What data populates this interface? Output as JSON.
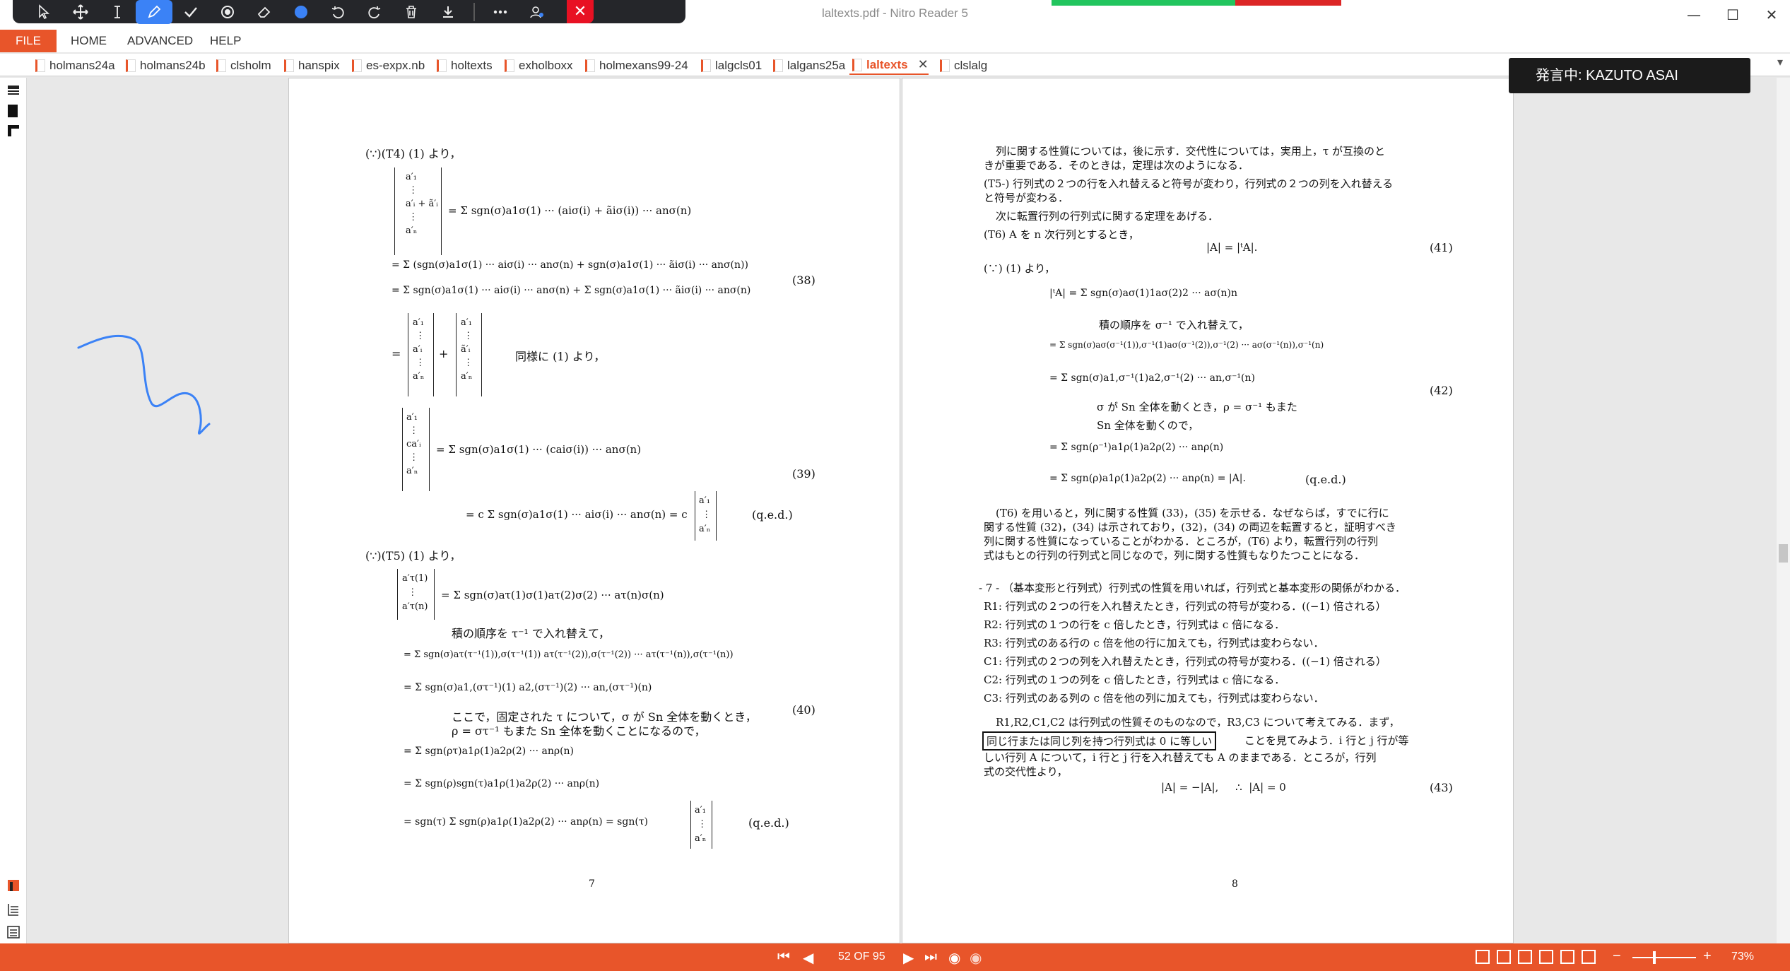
{
  "window": {
    "title": "laltexts.pdf - Nitro Reader 5",
    "minimize": "—",
    "maximize": "☐",
    "close": "✕"
  },
  "ink_toolbar": {
    "tools": [
      "select-arrow-icon",
      "move-icon",
      "text-cursor-icon",
      "pen-icon",
      "check-icon",
      "stamp-icon",
      "eraser-icon",
      "color-dot-icon",
      "undo-icon",
      "redo-icon",
      "trash-icon",
      "download-icon",
      "more-icon",
      "settings-icon"
    ],
    "active": "pen-icon",
    "accent": "#3b82f6",
    "close_color": "#e81123"
  },
  "menu": {
    "file": "FILE",
    "items": [
      "HOME",
      "ADVANCED",
      "HELP"
    ],
    "accent": "#e8552a"
  },
  "tabs": [
    {
      "label": "holmans24a"
    },
    {
      "label": "holmans24b"
    },
    {
      "label": "clsholm"
    },
    {
      "label": "hanspix"
    },
    {
      "label": "es-expx.nb"
    },
    {
      "label": "holtexts"
    },
    {
      "label": "exholboxx"
    },
    {
      "label": "holmexans99-24"
    },
    {
      "label": "lalgcls01"
    },
    {
      "label": "lalgans25a"
    },
    {
      "label": "laltexts",
      "active": true
    },
    {
      "label": "clslalg"
    }
  ],
  "tab_close": "✕",
  "speaker": {
    "text": "発言中: KAZUTO ASAI"
  },
  "page_left": {
    "lines": [
      "(∵)(T4) (1) より，",
      "= Σ sgn(σ)a1σ(1) ··· (aiσ(i) + ãiσ(i)) ··· anσ(n)",
      "= Σ (sgn(σ)a1σ(1) ··· aiσ(i) ··· anσ(n) + sgn(σ)a1σ(1) ··· ãiσ(i) ··· anσ(n))",
      "= Σ sgn(σ)a1σ(1) ··· aiσ(i) ··· anσ(n) + Σ sgn(σ)a1σ(1) ··· ãiσ(i) ··· anσ(n)",
      "同様に (1) より，",
      "= Σ sgn(σ)a1σ(1) ··· (caiσ(i)) ··· anσ(n)",
      "= c Σ sgn(σ)a1σ(1) ··· aiσ(i) ··· anσ(n) = c",
      "(q.e.d.)",
      "(∵)(T5) (1) より，",
      "= Σ sgn(σ)aτ(1)σ(1)aτ(2)σ(2) ··· aτ(n)σ(n)",
      "積の順序を τ⁻¹ で入れ替えて，",
      "= Σ sgn(σ)aτ(τ⁻¹(1)),σ(τ⁻¹(1)) aτ(τ⁻¹(2)),σ(τ⁻¹(2)) ··· aτ(τ⁻¹(n)),σ(τ⁻¹(n))",
      "= Σ sgn(σ)a1,(στ⁻¹)(1) a2,(στ⁻¹)(2) ··· an,(στ⁻¹)(n)",
      "ここで，固定された τ について，σ が Sn 全体を動くとき，",
      "ρ = στ⁻¹ もまた Sn 全体を動くことになるので，",
      "= Σ sgn(ρτ)a1ρ(1)a2ρ(2) ··· anρ(n)",
      "= Σ sgn(ρ)sgn(τ)a1ρ(1)a2ρ(2) ··· anρ(n)",
      "= sgn(τ) Σ sgn(ρ)a1ρ(1)a2ρ(2) ··· anρ(n) = sgn(τ)",
      "(q.e.d.)"
    ],
    "eq_numbers": [
      "(38)",
      "(39)",
      "(40)"
    ],
    "page_number": "7"
  },
  "page_right": {
    "lines": [
      "列に関する性質については，後に示す．交代性については，実用上，τ が互換のと",
      "きが重要である．そのときは，定理は次のようになる．",
      "(T5-) 行列式の２つの行を入れ替えると符号が変わり，行列式の２つの列を入れ替える",
      "と符号が変わる．",
      "次に転置行列の行列式に関する定理をあげる．",
      "(T6) A を n 次行列とするとき，",
      "|A| = |ᵗA|.",
      "(∵) (1) より，",
      "|ᵗA| = Σ sgn(σ)aσ(1)1aσ(2)2 ··· aσ(n)n",
      "積の順序を σ⁻¹ で入れ替えて，",
      "= Σ sgn(σ)aσ(σ⁻¹(1)),σ⁻¹(1)aσ(σ⁻¹(2)),σ⁻¹(2) ··· aσ(σ⁻¹(n)),σ⁻¹(n)",
      "= Σ sgn(σ)a1,σ⁻¹(1)a2,σ⁻¹(2) ··· an,σ⁻¹(n)",
      "σ が Sn 全体を動くとき，ρ = σ⁻¹ もまた",
      "Sn 全体を動くので，",
      "= Σ sgn(ρ⁻¹)a1ρ(1)a2ρ(2) ··· anρ(n)",
      "= Σ sgn(ρ)a1ρ(1)a2ρ(2) ··· anρ(n) = |A|.",
      "(q.e.d.)",
      "(T6) を用いると，列に関する性質 (33)，(35) を示せる．なぜならば，すでに行に",
      "関する性質 (32)，(34) は示されており，(32)，(34) の両辺を転置すると，証明すべき",
      "列に関する性質になっていることがわかる．ところが，(T6) より，転置行列の行列",
      "式はもとの行列の行列式と同じなので，列に関する性質もなりたつことになる．",
      "- 7 - （基本変形と行列式）行列式の性質を用いれば，行列式と基本変形の関係がわかる．",
      "R1: 行列式の２つの行を入れ替えたとき，行列式の符号が変わる．((−1) 倍される）",
      "R2: 行列式の１つの行を c 倍したとき，行列式は c 倍になる．",
      "R3: 行列式のある行の c 倍を他の行に加えても，行列式は変わらない．",
      "C1: 行列式の２つの列を入れ替えたとき，行列式の符号が変わる．((−1) 倍される）",
      "C2: 行列式の１つの列を c 倍したとき，行列式は c 倍になる．",
      "C3: 行列式のある列の c 倍を他の列に加えても，行列式は変わらない．",
      "R1,R2,C1,C2 は行列式の性質そのものなので，R3,C3 について考えてみる．まず，",
      "同じ行または同じ列を持つ行列式は 0 に等しい",
      "ことを見てみよう．i 行と j 行が等",
      "しい行列 A について，i 行と j 行を入れ替えても A のままである．ところが，行列",
      "式の交代性より，",
      "|A| = −|A|,     ∴  |A| = 0"
    ],
    "eq_numbers": [
      "(41)",
      "(42)",
      "(43)"
    ],
    "page_number": "8"
  },
  "status": {
    "page_indicator": "52 OF 95",
    "zoom": "73%",
    "zoom_minus": "−",
    "zoom_plus": "+"
  },
  "ink_color": "#3b82f6"
}
